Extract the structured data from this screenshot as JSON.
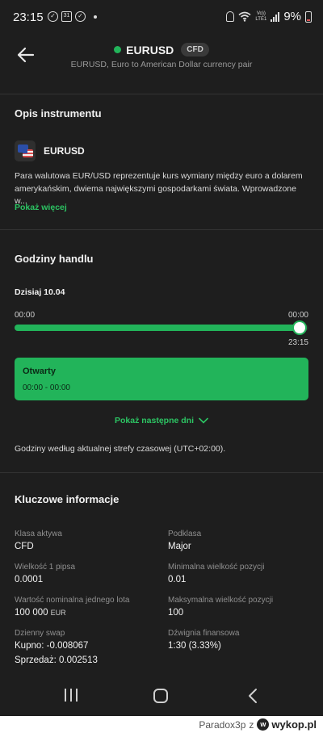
{
  "status_bar": {
    "time": "23:15",
    "calendar_day": "31",
    "network_label_top": "Vo))",
    "network_label_bottom": "LTE1",
    "battery_percent": "9%"
  },
  "header": {
    "symbol": "EURUSD",
    "badge": "CFD",
    "subtitle": "EURUSD, Euro to American Dollar currency pair"
  },
  "instrument_description": {
    "section_title": "Opis instrumentu",
    "instrument_name": "EURUSD",
    "description": "Para walutowa EUR/USD reprezentuje kurs wymiany między euro a dolarem amerykańskim, dwiema największymi gospodarkami świata. Wprowadzone w...",
    "show_more_label": "Pokaż więcej"
  },
  "trading_hours": {
    "section_title": "Godziny handlu",
    "day_label": "Dzisiaj 10.04",
    "start_label": "00:00",
    "end_label": "00:00",
    "current_time": "23:15",
    "progress_fraction": 0.969,
    "status_title": "Otwarty",
    "status_hours": "00:00 - 00:00",
    "next_days_label": "Pokaż następne dni",
    "timezone_note": "Godziny według aktualnej strefy czasowej (UTC+02:00)."
  },
  "key_info": {
    "section_title": "Kluczowe informacje",
    "asset_class_label": "Klasa aktywa",
    "asset_class_value": "CFD",
    "subclass_label": "Podklasa",
    "subclass_value": "Major",
    "pip_size_label": "Wielkość 1 pipsa",
    "pip_size_value": "0.0001",
    "min_position_label": "Minimalna wielkość pozycji",
    "min_position_value": "0.01",
    "lot_value_label": "Wartość nominalna jednego lota",
    "lot_value_value": "100 000",
    "lot_value_unit": "EUR",
    "max_position_label": "Maksymalna wielkość pozycji",
    "max_position_value": "100",
    "swap_label": "Dzienny swap",
    "swap_buy": "Kupno: -0.008067",
    "swap_sell": "Sprzedaż: 0.002513",
    "leverage_label": "Dźwignia finansowa",
    "leverage_value": "1:30 (3.33%)"
  },
  "footer": {
    "username": "Paradox3p",
    "connector": "z",
    "site": "wykop.pl"
  },
  "colors": {
    "background": "#1e1e1e",
    "accent_green": "#22b45a",
    "link_green": "#2cc463"
  }
}
